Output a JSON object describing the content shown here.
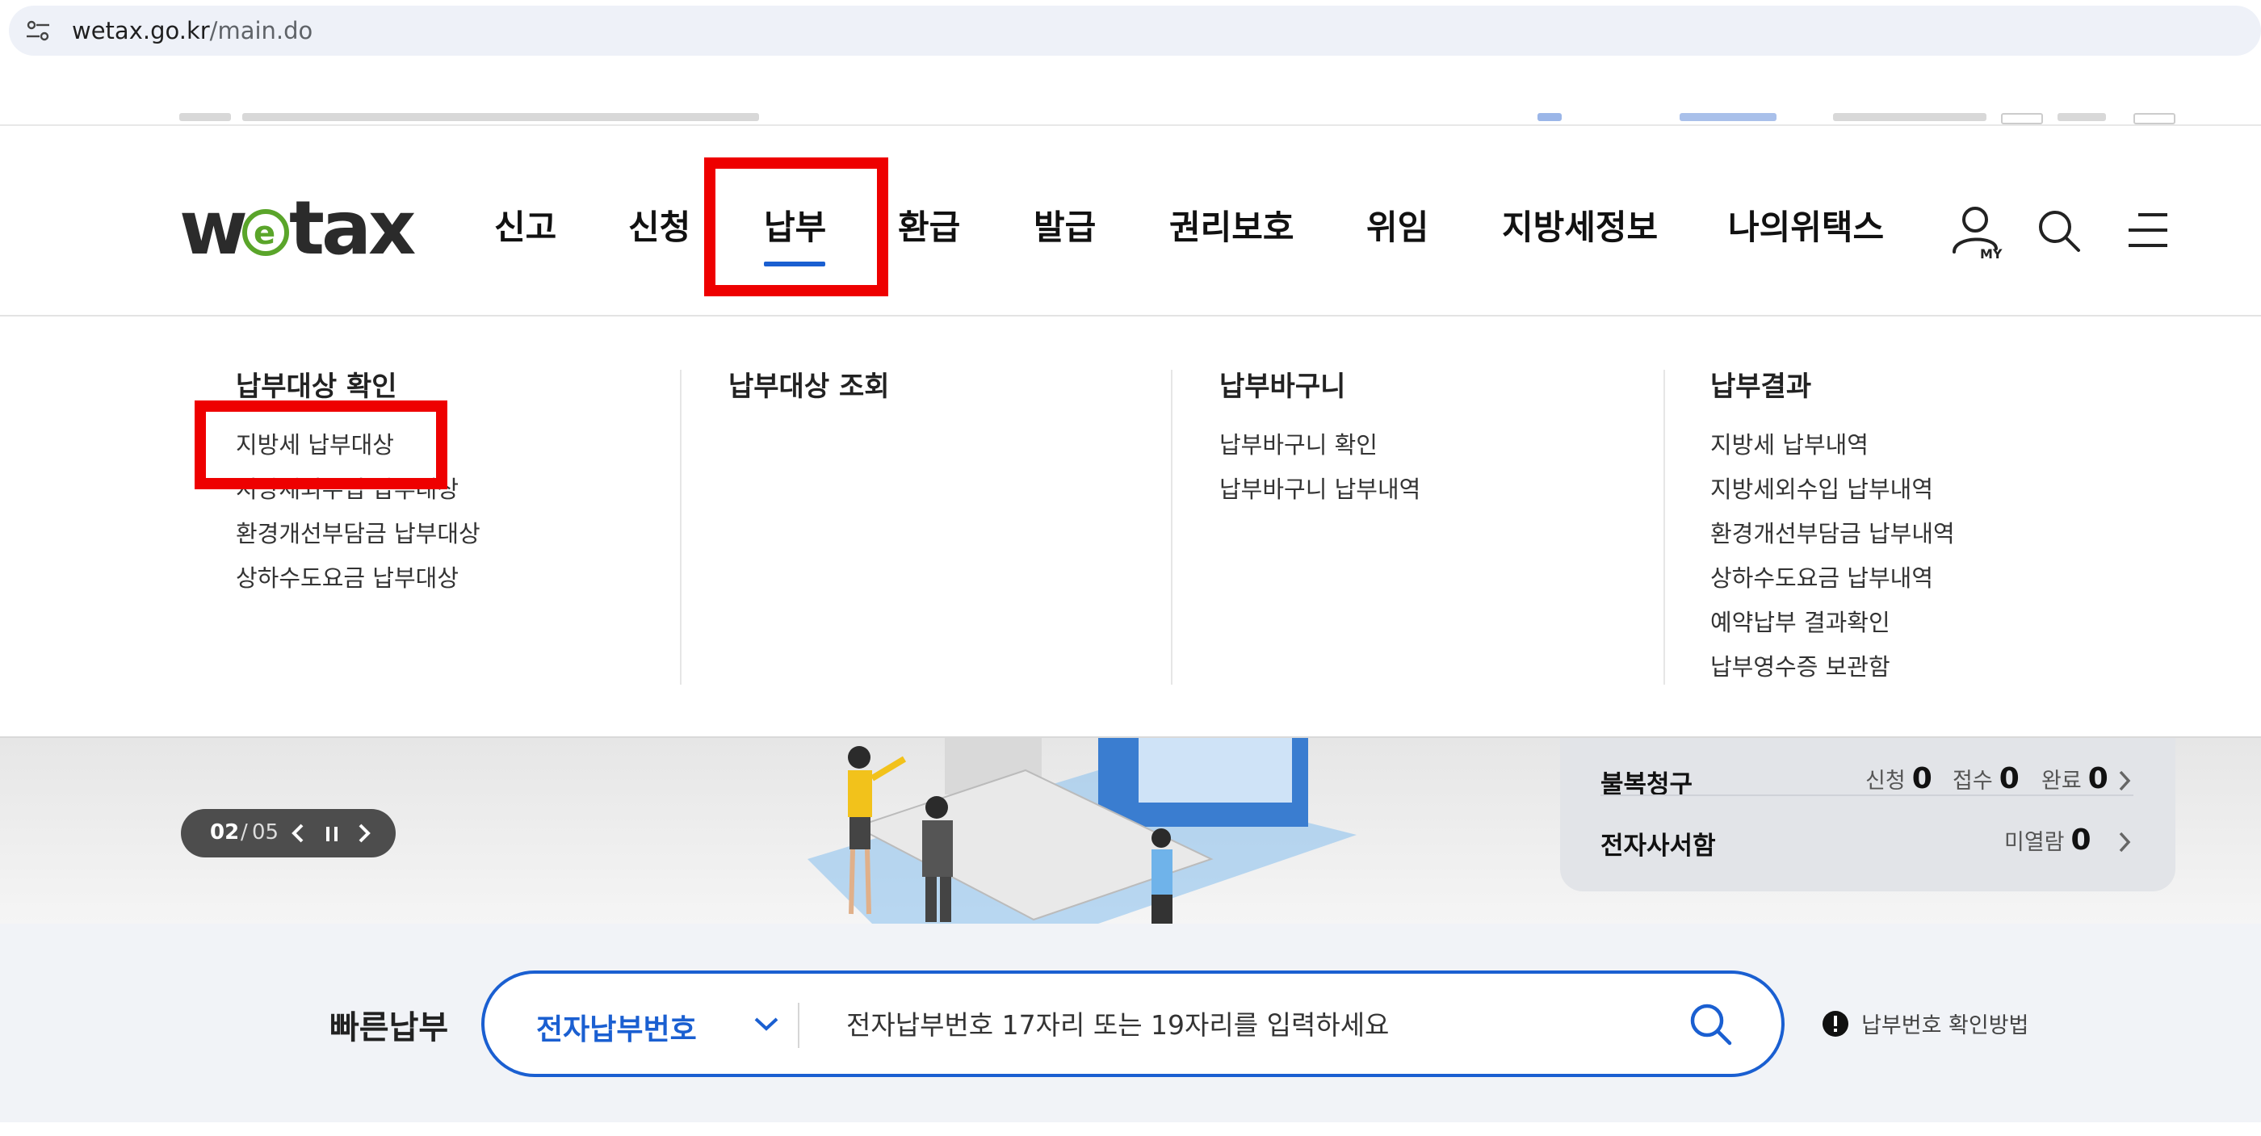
{
  "browser": {
    "url_host": "wetax.go.kr",
    "url_path": "/main.do",
    "site_info_icon": "tune-icon"
  },
  "header": {
    "logo_text": "wetax",
    "nav": [
      {
        "label": "신고"
      },
      {
        "label": "신청"
      },
      {
        "label": "납부",
        "active": true
      },
      {
        "label": "환급"
      },
      {
        "label": "발급"
      },
      {
        "label": "권리보호"
      },
      {
        "label": "위임"
      },
      {
        "label": "지방세정보"
      },
      {
        "label": "나의위택스"
      }
    ],
    "my_badge": "MY",
    "icons": [
      "my-page-icon",
      "search-icon",
      "menu-icon"
    ],
    "accent_color": "#1a5fd1",
    "highlight_color": "#ee0000"
  },
  "mega_menu": {
    "columns": [
      {
        "title": "납부대상 확인",
        "items": [
          "지방세 납부대상",
          "지방세외수입 납부대상",
          "환경개선부담금 납부대상",
          "상하수도요금 납부대상"
        ]
      },
      {
        "title": "납부대상 조회",
        "items": []
      },
      {
        "title": "납부바구니",
        "items": [
          "납부바구니 확인",
          "납부바구니 납부내역"
        ]
      },
      {
        "title": "납부결과",
        "items": [
          "지방세 납부내역",
          "지방세외수입 납부내역",
          "환경개선부담금 납부내역",
          "상하수도요금 납부내역",
          "예약납부 결과확인",
          "납부영수증 보관함"
        ]
      }
    ]
  },
  "banner": {
    "current": "02",
    "separator": "/",
    "total": "05",
    "controls": [
      "chevron-left-icon",
      "pause-icon",
      "chevron-right-icon"
    ]
  },
  "status_panel": {
    "rows": [
      {
        "title": "불복청구",
        "pairs": [
          {
            "label": "신청",
            "value": "0"
          },
          {
            "label": "접수",
            "value": "0"
          },
          {
            "label": "완료",
            "value": "0"
          }
        ]
      },
      {
        "title": "전자사서함",
        "pairs": [
          {
            "label": "미열람",
            "value": "0"
          }
        ]
      }
    ]
  },
  "quick_pay": {
    "label": "빠른납부",
    "select_value": "전자납부번호",
    "input_placeholder": "전자납부번호 17자리 또는 19자리를 입력하세요",
    "help_text": "납부번호 확인방법"
  }
}
